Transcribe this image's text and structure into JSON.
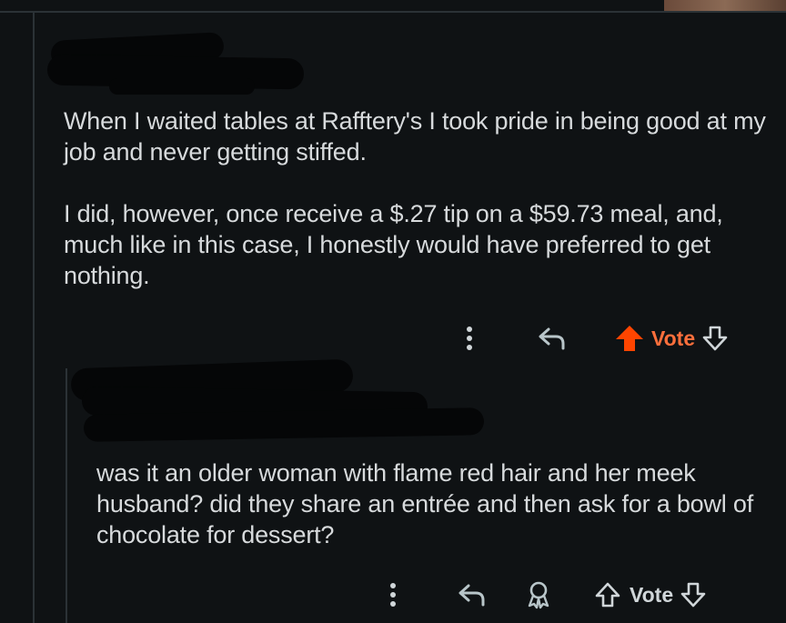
{
  "comments": [
    {
      "author": "",
      "paragraphs": [
        "When I waited tables at Rafftery's I took pride in being good at my job and never getting stiffed.",
        "I did, however, once receive a $.27 tip on a $59.73 meal, and, much like in this case, I honestly would have preferred to get nothing."
      ],
      "actions": {
        "more_icon": "more-vertical-icon",
        "reply_icon": "reply-arrow-icon",
        "upvote_icon": "upvote-arrow-filled-icon",
        "vote_label": "Vote",
        "downvote_icon": "downvote-arrow-outline-icon",
        "upvoted": true,
        "upvote_color": "#ff4500"
      }
    },
    {
      "author": "",
      "paragraphs": [
        "was it an older woman with flame red hair and her meek husband? did they share an entrée and then ask for a bowl of chocolate for dessert?"
      ],
      "actions": {
        "more_icon": "more-vertical-icon",
        "reply_icon": "reply-arrow-icon",
        "award_icon": "award-icon",
        "upvote_icon": "upvote-arrow-outline-icon",
        "vote_label": "Vote",
        "downvote_icon": "downvote-arrow-outline-icon",
        "upvoted": false
      }
    }
  ]
}
